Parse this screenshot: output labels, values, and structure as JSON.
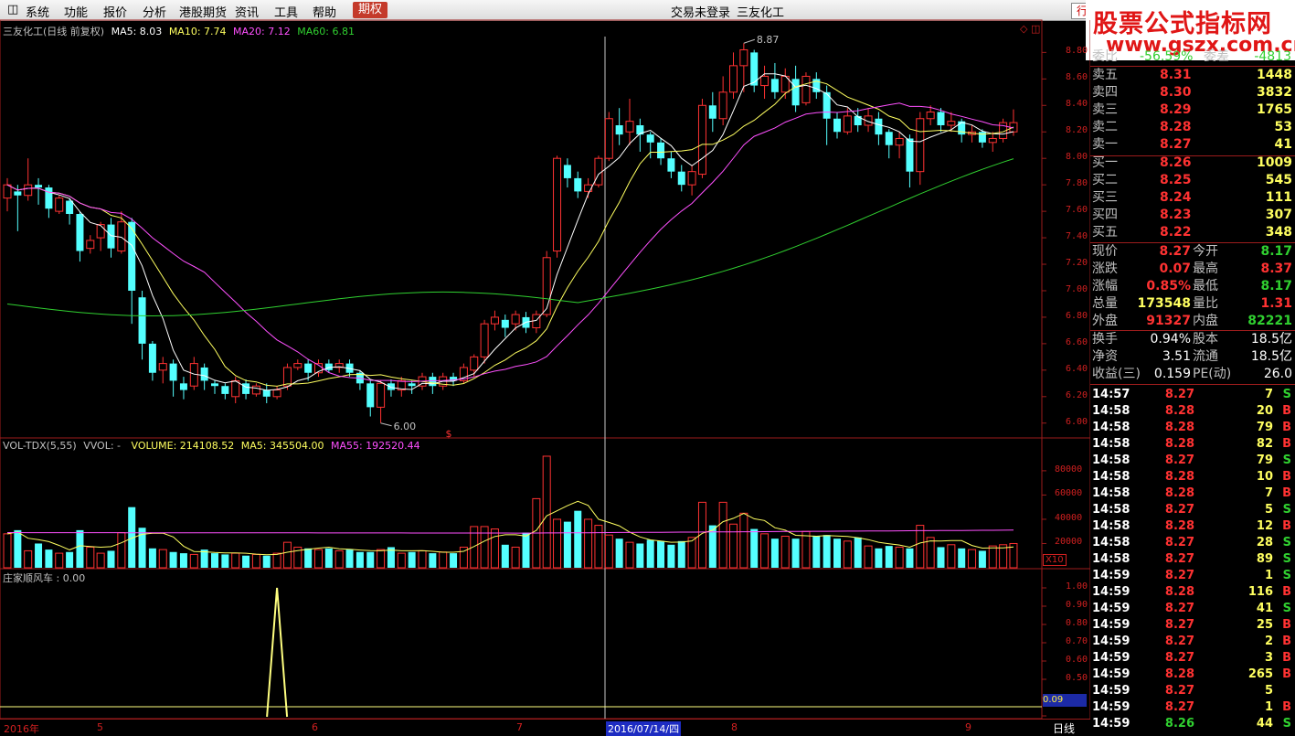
{
  "menubar": {
    "items": [
      "系统",
      "功能",
      "报价",
      "分析",
      "港股期货",
      "资讯",
      "工具",
      "帮助"
    ],
    "active": "期权",
    "status": "交易未登录",
    "stock": "三友化工",
    "right_button": "行"
  },
  "watermark": {
    "line1": "股票公式指标网",
    "line2": "www.gszx.com.cn"
  },
  "colors": {
    "up": "#ff3232",
    "down": "#54ffff",
    "ma5": "#ffffff",
    "ma10": "#ffff60",
    "ma20": "#ff50ff",
    "ma60": "#30d030"
  },
  "price_panel": {
    "name": "三友化工(日线 前复权)",
    "ma5": "MA5: 8.03",
    "ma10": "MA10: 7.74",
    "ma20": "MA20: 7.12",
    "ma60": "MA60: 6.81",
    "y_ticks": [
      "8.80",
      "8.60",
      "8.40",
      "8.20",
      "8.00",
      "7.80",
      "7.60",
      "7.40",
      "7.20",
      "7.00",
      "6.80",
      "6.60",
      "6.40",
      "6.20",
      "6.00"
    ],
    "high_label": "8.87",
    "low_label": "6.00",
    "marker": "$"
  },
  "volume_panel": {
    "name": "VOL-TDX(5,55)",
    "vvol": "VVOL: -",
    "volume": "VOLUME: 214108.52",
    "ma5": "MA5: 345504.00",
    "ma55": "MA55: 192520.44",
    "y_ticks": [
      "80000",
      "60000",
      "40000",
      "20000"
    ],
    "unit": "X10"
  },
  "indicator_panel": {
    "name": "庄家顺风车 : 0.00",
    "y_ticks": [
      "1.00",
      "0.90",
      "0.80",
      "0.70",
      "0.60",
      "0.50",
      "0.40",
      "0.30"
    ],
    "value_box": "0.09"
  },
  "x_axis": {
    "labels": [
      {
        "text": "2016年",
        "hl": false
      },
      {
        "text": "5",
        "hl": false
      },
      {
        "text": "6",
        "hl": false
      },
      {
        "text": "7",
        "hl": false
      },
      {
        "text": "2016/07/14/四",
        "hl": true
      },
      {
        "text": "8",
        "hl": false
      },
      {
        "text": "9",
        "hl": false
      }
    ],
    "period": "日线"
  },
  "chart_data": {
    "type": "candlestick",
    "candles": [
      [
        7.7,
        7.8,
        7.6,
        7.85
      ],
      [
        7.75,
        7.72,
        7.45,
        7.8
      ],
      [
        7.72,
        7.8,
        7.68,
        8.0
      ],
      [
        7.8,
        7.78,
        7.65,
        7.85
      ],
      [
        7.78,
        7.62,
        7.55,
        7.8
      ],
      [
        7.6,
        7.7,
        7.58,
        7.72
      ],
      [
        7.68,
        7.58,
        7.5,
        7.7
      ],
      [
        7.58,
        7.3,
        7.22,
        7.6
      ],
      [
        7.32,
        7.38,
        7.28,
        7.42
      ],
      [
        7.4,
        7.5,
        7.3,
        7.52
      ],
      [
        7.5,
        7.32,
        7.25,
        7.55
      ],
      [
        7.3,
        7.52,
        7.28,
        7.6
      ],
      [
        7.52,
        7.0,
        6.75,
        7.55
      ],
      [
        6.95,
        6.6,
        6.48,
        7.0
      ],
      [
        6.6,
        6.38,
        6.32,
        6.62
      ],
      [
        6.4,
        6.45,
        6.3,
        6.5
      ],
      [
        6.45,
        6.32,
        6.2,
        6.48
      ],
      [
        6.3,
        6.25,
        6.18,
        6.35
      ],
      [
        6.28,
        6.45,
        6.25,
        6.5
      ],
      [
        6.42,
        6.32,
        6.25,
        6.45
      ],
      [
        6.3,
        6.28,
        6.22,
        6.32
      ],
      [
        6.28,
        6.22,
        6.18,
        6.3
      ],
      [
        6.2,
        6.32,
        6.15,
        6.35
      ],
      [
        6.3,
        6.22,
        6.18,
        6.33
      ],
      [
        6.22,
        6.28,
        6.2,
        6.3
      ],
      [
        6.25,
        6.2,
        6.15,
        6.3
      ],
      [
        6.2,
        6.25,
        6.18,
        6.28
      ],
      [
        6.28,
        6.42,
        6.25,
        6.45
      ],
      [
        6.42,
        6.45,
        6.4,
        6.48
      ],
      [
        6.45,
        6.38,
        6.32,
        6.48
      ],
      [
        6.38,
        6.45,
        6.35,
        6.48
      ],
      [
        6.45,
        6.4,
        6.38,
        6.48
      ],
      [
        6.42,
        6.45,
        6.38,
        6.48
      ],
      [
        6.45,
        6.38,
        6.35,
        6.48
      ],
      [
        6.38,
        6.3,
        6.25,
        6.4
      ],
      [
        6.3,
        6.12,
        6.05,
        6.32
      ],
      [
        6.12,
        6.3,
        6.0,
        6.32
      ],
      [
        6.3,
        6.25,
        6.2,
        6.33
      ],
      [
        6.25,
        6.32,
        6.2,
        6.35
      ],
      [
        6.3,
        6.28,
        6.22,
        6.32
      ],
      [
        6.28,
        6.35,
        6.25,
        6.38
      ],
      [
        6.35,
        6.28,
        6.22,
        6.38
      ],
      [
        6.28,
        6.35,
        6.25,
        6.38
      ],
      [
        6.35,
        6.32,
        6.28,
        6.38
      ],
      [
        6.32,
        6.42,
        6.3,
        6.45
      ],
      [
        6.4,
        6.5,
        6.35,
        6.52
      ],
      [
        6.5,
        6.75,
        6.45,
        6.78
      ],
      [
        6.75,
        6.8,
        6.7,
        6.85
      ],
      [
        6.78,
        6.72,
        6.65,
        6.82
      ],
      [
        6.75,
        6.82,
        6.7,
        6.85
      ],
      [
        6.8,
        6.72,
        6.68,
        6.84
      ],
      [
        6.72,
        6.82,
        6.68,
        6.85
      ],
      [
        6.82,
        7.25,
        6.8,
        7.3
      ],
      [
        7.3,
        8.0,
        7.25,
        8.02
      ],
      [
        7.95,
        7.85,
        7.78,
        8.0
      ],
      [
        7.85,
        7.75,
        7.7,
        7.9
      ],
      [
        7.75,
        7.8,
        7.7,
        7.85
      ],
      [
        7.8,
        8.0,
        7.78,
        8.02
      ],
      [
        8.0,
        8.3,
        7.98,
        8.35
      ],
      [
        8.25,
        8.18,
        8.1,
        8.38
      ],
      [
        8.2,
        8.28,
        8.1,
        8.45
      ],
      [
        8.25,
        8.18,
        8.05,
        8.3
      ],
      [
        8.18,
        8.12,
        8.0,
        8.2
      ],
      [
        8.12,
        8.0,
        7.95,
        8.15
      ],
      [
        8.0,
        7.9,
        7.85,
        8.05
      ],
      [
        7.9,
        7.8,
        7.75,
        7.95
      ],
      [
        7.8,
        7.9,
        7.72,
        7.95
      ],
      [
        7.88,
        8.4,
        7.85,
        8.45
      ],
      [
        8.4,
        8.3,
        8.2,
        8.5
      ],
      [
        8.3,
        8.5,
        8.25,
        8.62
      ],
      [
        8.5,
        8.7,
        8.45,
        8.8
      ],
      [
        8.7,
        8.82,
        8.5,
        8.87
      ],
      [
        8.8,
        8.55,
        8.5,
        8.82
      ],
      [
        8.55,
        8.62,
        8.45,
        8.7
      ],
      [
        8.6,
        8.5,
        8.45,
        8.72
      ],
      [
        8.5,
        8.62,
        8.45,
        8.68
      ],
      [
        8.6,
        8.4,
        8.35,
        8.7
      ],
      [
        8.42,
        8.62,
        8.4,
        8.65
      ],
      [
        8.6,
        8.5,
        8.45,
        8.65
      ],
      [
        8.5,
        8.3,
        8.1,
        8.55
      ],
      [
        8.3,
        8.2,
        8.15,
        8.35
      ],
      [
        8.2,
        8.32,
        8.18,
        8.38
      ],
      [
        8.32,
        8.25,
        8.2,
        8.38
      ],
      [
        8.25,
        8.32,
        8.2,
        8.38
      ],
      [
        8.3,
        8.18,
        8.1,
        8.35
      ],
      [
        8.2,
        8.1,
        8.0,
        8.22
      ],
      [
        8.1,
        8.15,
        8.0,
        8.2
      ],
      [
        8.15,
        7.9,
        7.78,
        8.18
      ],
      [
        7.9,
        8.3,
        7.8,
        8.35
      ],
      [
        8.3,
        8.35,
        8.25,
        8.4
      ],
      [
        8.35,
        8.25,
        8.2,
        8.38
      ],
      [
        8.25,
        8.28,
        8.2,
        8.35
      ],
      [
        8.28,
        8.18,
        8.12,
        8.3
      ],
      [
        8.18,
        8.2,
        8.12,
        8.25
      ],
      [
        8.2,
        8.12,
        8.08,
        8.22
      ],
      [
        8.12,
        8.15,
        8.05,
        8.2
      ],
      [
        8.15,
        8.27,
        8.12,
        8.3
      ],
      [
        8.2,
        8.27,
        8.17,
        8.37
      ]
    ],
    "volume": [
      28000,
      31000,
      14000,
      20000,
      15000,
      12000,
      13000,
      31000,
      17000,
      12000,
      14000,
      29000,
      50000,
      33000,
      16000,
      15000,
      13000,
      12000,
      11000,
      15000,
      12000,
      11000,
      12000,
      10000,
      11000,
      10000,
      12000,
      21000,
      17000,
      16000,
      15000,
      16000,
      14000,
      15000,
      13000,
      13000,
      15000,
      17000,
      12000,
      13000,
      14000,
      12000,
      13000,
      12000,
      17000,
      34000,
      34000,
      32000,
      19000,
      17000,
      29000,
      57000,
      92000,
      40000,
      38000,
      47000,
      40000,
      35000,
      27000,
      24000,
      21000,
      20000,
      23000,
      22000,
      19000,
      22000,
      25000,
      54000,
      35000,
      54000,
      36000,
      45000,
      32000,
      28000,
      24000,
      26000,
      24000,
      30000,
      26000,
      27000,
      24000,
      22000,
      25000,
      18000,
      16000,
      18000,
      17000,
      16000,
      35000,
      25000,
      17000,
      19000,
      16000,
      15000,
      14000,
      18000,
      19000,
      20000
    ],
    "spike_at": 26
  },
  "quote": {
    "header": {
      "label": "委比",
      "value": "-56.59%",
      "label2": "委差",
      "value2": "-4813"
    },
    "sells": [
      {
        "label": "卖五",
        "price": "8.31",
        "vol": "1448"
      },
      {
        "label": "卖四",
        "price": "8.30",
        "vol": "3832"
      },
      {
        "label": "卖三",
        "price": "8.29",
        "vol": "1765"
      },
      {
        "label": "卖二",
        "price": "8.28",
        "vol": "53"
      },
      {
        "label": "卖一",
        "price": "8.27",
        "vol": "41"
      }
    ],
    "buys": [
      {
        "label": "买一",
        "price": "8.26",
        "vol": "1009"
      },
      {
        "label": "买二",
        "price": "8.25",
        "vol": "545"
      },
      {
        "label": "买三",
        "price": "8.24",
        "vol": "111"
      },
      {
        "label": "买四",
        "price": "8.23",
        "vol": "307"
      },
      {
        "label": "买五",
        "price": "8.22",
        "vol": "348"
      }
    ],
    "stats": [
      {
        "l1": "现价",
        "v1": "8.27",
        "c1": "#ff3232",
        "l2": "今开",
        "v2": "8.17",
        "c2": "#30d030"
      },
      {
        "l1": "涨跌",
        "v1": "0.07",
        "c1": "#ff3232",
        "l2": "最高",
        "v2": "8.37",
        "c2": "#ff3232"
      },
      {
        "l1": "涨幅",
        "v1": "0.85%",
        "c1": "#ff3232",
        "l2": "最低",
        "v2": "8.17",
        "c2": "#30d030"
      },
      {
        "l1": "总量",
        "v1": "173548",
        "c1": "#ffff60",
        "l2": "量比",
        "v2": "1.31",
        "c2": "#ff3232"
      },
      {
        "l1": "外盘",
        "v1": "91327",
        "c1": "#ff3232",
        "l2": "内盘",
        "v2": "82221",
        "c2": "#30d030"
      }
    ],
    "stats2": [
      {
        "l1": "换手",
        "v1": "0.94%",
        "l2": "股本",
        "v2": "18.5亿"
      },
      {
        "l1": "净资",
        "v1": "3.51",
        "l2": "流通",
        "v2": "18.5亿"
      },
      {
        "l1": "收益(三)",
        "v1": "0.159",
        "l2": "PE(动)",
        "v2": "26.0"
      }
    ],
    "ticks": [
      {
        "t": "14:57",
        "p": "8.27",
        "v": "7",
        "s": "S"
      },
      {
        "t": "14:58",
        "p": "8.28",
        "v": "20",
        "s": "B"
      },
      {
        "t": "14:58",
        "p": "8.28",
        "v": "79",
        "s": "B"
      },
      {
        "t": "14:58",
        "p": "8.28",
        "v": "82",
        "s": "B"
      },
      {
        "t": "14:58",
        "p": "8.27",
        "v": "79",
        "s": "S"
      },
      {
        "t": "14:58",
        "p": "8.28",
        "v": "10",
        "s": "B"
      },
      {
        "t": "14:58",
        "p": "8.28",
        "v": "7",
        "s": "B"
      },
      {
        "t": "14:58",
        "p": "8.27",
        "v": "5",
        "s": "S"
      },
      {
        "t": "14:58",
        "p": "8.28",
        "v": "12",
        "s": "B"
      },
      {
        "t": "14:58",
        "p": "8.27",
        "v": "28",
        "s": "S"
      },
      {
        "t": "14:58",
        "p": "8.27",
        "v": "89",
        "s": "S"
      },
      {
        "t": "14:59",
        "p": "8.27",
        "v": "1",
        "s": "S"
      },
      {
        "t": "14:59",
        "p": "8.28",
        "v": "116",
        "s": "B"
      },
      {
        "t": "14:59",
        "p": "8.27",
        "v": "41",
        "s": "S"
      },
      {
        "t": "14:59",
        "p": "8.27",
        "v": "25",
        "s": "B"
      },
      {
        "t": "14:59",
        "p": "8.27",
        "v": "2",
        "s": "B"
      },
      {
        "t": "14:59",
        "p": "8.27",
        "v": "3",
        "s": "B"
      },
      {
        "t": "14:59",
        "p": "8.28",
        "v": "265",
        "s": "B"
      },
      {
        "t": "14:59",
        "p": "8.27",
        "v": "5",
        "s": ""
      },
      {
        "t": "14:59",
        "p": "8.27",
        "v": "1",
        "s": "B"
      },
      {
        "t": "14:59",
        "p": "8.26",
        "v": "44",
        "s": "S"
      }
    ]
  }
}
